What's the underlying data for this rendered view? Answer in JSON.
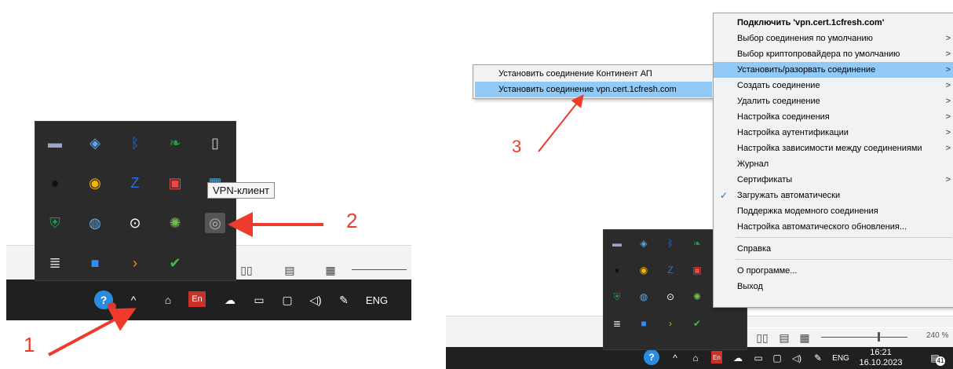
{
  "left": {
    "tooltip": "VPN-клиент",
    "callout_1": "1",
    "callout_2": "2",
    "language_badge": "En",
    "input_language": "ENG",
    "tray_icons": [
      {
        "name": "monitor-app-icon",
        "color": "#9aa7c9"
      },
      {
        "name": "shield-app-icon",
        "color": "#5aa6e8"
      },
      {
        "name": "bluetooth-icon",
        "color": "#1e6fd9"
      },
      {
        "name": "green-leaf-icon",
        "color": "#1e9e4a"
      },
      {
        "name": "usb-drive-icon",
        "color": "#cfcfcf"
      },
      {
        "name": "bw-logo-icon",
        "color": "#111111"
      },
      {
        "name": "chrome-icon",
        "color": "#f2b600"
      },
      {
        "name": "z-app-icon",
        "color": "#2f6fe0"
      },
      {
        "name": "color-monitor-icon",
        "color": "#e84a4a"
      },
      {
        "name": "display-app-icon",
        "color": "#3fa7e0"
      },
      {
        "name": "defender-shield-icon",
        "color": "#1e9e4a"
      },
      {
        "name": "network-globe-icon",
        "color": "#5aaedc"
      },
      {
        "name": "power-circle-icon",
        "color": "#ffffff"
      },
      {
        "name": "dr-web-icon",
        "color": "#6cc04a"
      },
      {
        "name": "vpn-client-icon",
        "color": "#b0b0b0"
      },
      {
        "name": "router-icon",
        "color": "#dddddd"
      },
      {
        "name": "zoom-app-icon",
        "color": "#2d8cff"
      },
      {
        "name": "plex-icon",
        "color": "#e5a00d"
      },
      {
        "name": "check-app-icon",
        "color": "#46b946"
      }
    ]
  },
  "right": {
    "callout_3": "3",
    "input_language": "ENG",
    "clock_time": "16:21",
    "clock_date": "16.10.2023",
    "notification_count": "41",
    "zoom_level": "240 %",
    "menu": [
      {
        "label": "Подключить 'vpn.cert.1cfresh.com'",
        "bold": true
      },
      {
        "label": "Выбор соединения по умолчанию",
        "arrow": ">"
      },
      {
        "label": "Выбор криптопровайдера по умолчанию",
        "arrow": ">"
      },
      {
        "label": "Установить/разорвать соединение",
        "arrow": ">",
        "highlight": true
      },
      {
        "label": "Создать соединение",
        "arrow": ">"
      },
      {
        "label": "Удалить соединение",
        "arrow": ">"
      },
      {
        "label": "Настройка соединения",
        "arrow": ">"
      },
      {
        "label": "Настройка аутентификации",
        "arrow": ">"
      },
      {
        "label": "Настройка зависимости между соединениями",
        "arrow": ">"
      },
      {
        "label": "Журнал"
      },
      {
        "label": "Сертификаты",
        "arrow": ">"
      },
      {
        "label": "Загружать автоматически",
        "checked": true
      },
      {
        "label": "Поддержка модемного соединения"
      },
      {
        "label": "Настройка автоматического обновления..."
      },
      {
        "label": "Справка"
      },
      {
        "label": "О программе..."
      },
      {
        "label": "Выход"
      }
    ],
    "submenu": [
      {
        "label": "Установить соединение Континент АП"
      },
      {
        "label": "Установить соединение vpn.cert.1cfresh.com",
        "highlight": true
      }
    ]
  }
}
